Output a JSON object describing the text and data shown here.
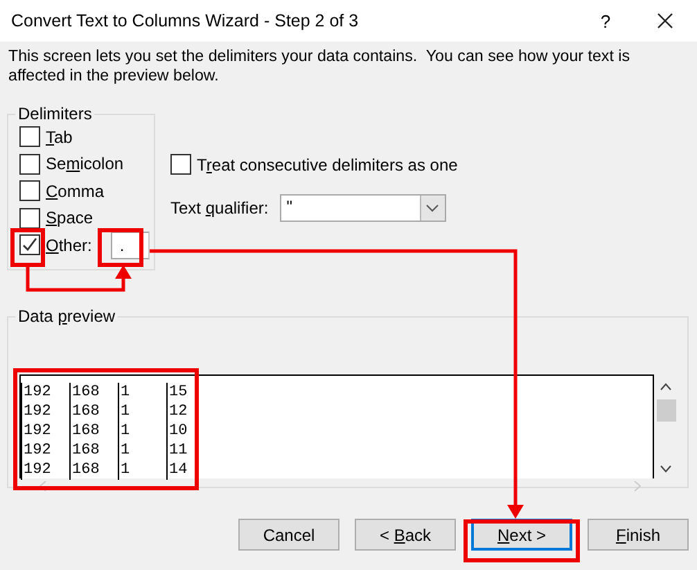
{
  "window": {
    "title": "Convert Text to Columns Wizard - Step 2 of 3",
    "help": "?"
  },
  "instructions": "This screen lets you set the delimiters your data contains.  You can see how your text is affected in the preview below.",
  "delimiters": {
    "title": "Delimiters",
    "options": [
      {
        "key": "T",
        "post": "ab",
        "checked": false
      },
      {
        "pre": "Se",
        "key": "m",
        "post": "icolon",
        "checked": false
      },
      {
        "key": "C",
        "post": "omma",
        "checked": false
      },
      {
        "key": "S",
        "post": "pace",
        "checked": false
      },
      {
        "key": "O",
        "post": "ther:",
        "checked": true
      }
    ],
    "other_value": "."
  },
  "consecutive": {
    "pre": "T",
    "key": "r",
    "post": "eat consecutive delimiters as one",
    "checked": false
  },
  "qualifier": {
    "pre": "Text ",
    "key": "q",
    "post": "ualifier:",
    "value": "\""
  },
  "preview": {
    "title_pre": "Data ",
    "title_key": "p",
    "title_post": "review",
    "rows": [
      [
        "192",
        "168",
        "1",
        "15"
      ],
      [
        "192",
        "168",
        "1",
        "12"
      ],
      [
        "192",
        "168",
        "1",
        "10"
      ],
      [
        "192",
        "168",
        "1",
        "11"
      ],
      [
        "192",
        "168",
        "1",
        "14"
      ]
    ]
  },
  "buttons": [
    {
      "pre": "Cancel",
      "default": false
    },
    {
      "pre": "< ",
      "key": "B",
      "post": "ack",
      "default": false
    },
    {
      "key": "N",
      "post": "ext >",
      "default": true
    },
    {
      "key": "F",
      "post": "inish",
      "default": false
    }
  ]
}
